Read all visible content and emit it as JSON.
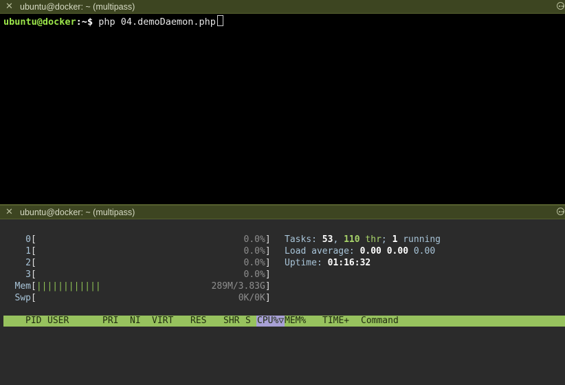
{
  "top_pane": {
    "title": "ubuntu@docker: ~ (multipass)",
    "prompt_user": "ubuntu@docker",
    "prompt_path": ":~",
    "prompt_symbol": "$",
    "command": " php 04.demoDaemon.php"
  },
  "bottom_pane": {
    "title": "ubuntu@docker: ~ (multipass)",
    "meters": [
      {
        "label": "0",
        "value": "0.0%"
      },
      {
        "label": "1",
        "value": "0.0%"
      },
      {
        "label": "2",
        "value": "0.0%"
      },
      {
        "label": "3",
        "value": "0.0%"
      },
      {
        "label": "Mem",
        "value": "289M/3.83G",
        "bars": "||||||||||||"
      },
      {
        "label": "Swp",
        "value": "0K/0K"
      }
    ],
    "tasks": {
      "label": "Tasks: ",
      "count": "53",
      "sep": ", ",
      "threads": "110",
      "thr_label": " thr",
      "semi": "; ",
      "running": "1",
      "running_label": " running"
    },
    "load": {
      "label": "Load average: ",
      "v1": "0.00",
      "v2": "0.00",
      "v3": "0.00"
    },
    "uptime": {
      "label": "Uptime: ",
      "value": "01:16:32"
    },
    "columns": {
      "pid": "PID",
      "user": "USER",
      "pri": "PRI",
      "ni": "NI",
      "virt": "VIRT",
      "res": "RES",
      "shr": "SHR",
      "s": "S",
      "cpu": "CPU%▽",
      "mem": "MEM%",
      "time": "TIME+",
      "command": "Command"
    }
  }
}
